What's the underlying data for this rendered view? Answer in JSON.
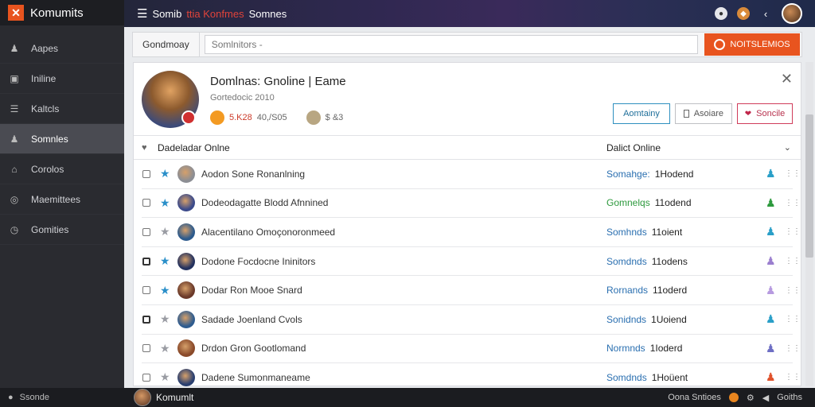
{
  "app": {
    "name": "Komumits",
    "logo_glyph": "✕"
  },
  "sidebar": {
    "items": [
      {
        "label": "Aapes",
        "icon": "person-icon",
        "glyph": "♟"
      },
      {
        "label": "Iniline",
        "icon": "bookmark-icon",
        "glyph": "▣"
      },
      {
        "label": "Kaltcls",
        "icon": "list-icon",
        "glyph": "☰"
      },
      {
        "label": "Somnles",
        "icon": "users-icon",
        "glyph": "♟",
        "active": true
      },
      {
        "label": "Corolos",
        "icon": "home-icon",
        "glyph": "⌂"
      },
      {
        "label": "Maemittees",
        "icon": "target-icon",
        "glyph": "◎"
      },
      {
        "label": "Gomities",
        "icon": "clock-icon",
        "glyph": "◷"
      }
    ]
  },
  "topbar": {
    "menu_glyph": "☰",
    "title_start": "Somib",
    "title_mid": "ttia Konfmes",
    "title_end": "Somnes"
  },
  "search": {
    "label": "Gondmoay",
    "placeholder": "Somlnitors -",
    "button_label": "NOITSLEMIOS"
  },
  "profile": {
    "name": "Domlnas: Gnoline | Eame",
    "subtitle": "Gortedocic 2010",
    "stat_a": "5.K28",
    "stat_b": "40,/S05",
    "stat_c": "$ &3",
    "close_glyph": "✕",
    "actions": {
      "primary": "Aomtainy",
      "secondary": "Asoiare",
      "danger": "Soncile"
    }
  },
  "list": {
    "header_left": "Dadeladar Onlne",
    "header_right": "Dalict Online",
    "rows": [
      {
        "name": "Aodon Sone Ronanlning",
        "status": "Somahge:",
        "count": "1Hodend",
        "starred": true,
        "checked": false,
        "avatar": "#8c8e94",
        "person": "#2a9fc8",
        "status_color": "blue"
      },
      {
        "name": "Dodeodagatte Blodd Afnnined",
        "status": "Gomnelqs",
        "count": "11odend",
        "starred": true,
        "checked": false,
        "avatar": "#3b4a8a",
        "person": "#2e9a3e",
        "status_color": "green"
      },
      {
        "name": "Alacentilano Omoçonoronmeed",
        "status": "Somhnds",
        "count": "11oient",
        "starred": false,
        "checked": false,
        "avatar": "#2c5a8c",
        "person": "#2a9fc8",
        "status_color": "blue"
      },
      {
        "name": "Dodone Focdocne Ininitors",
        "status": "Somdnds",
        "count": "11odens",
        "starred": true,
        "checked": true,
        "avatar": "#23315e",
        "person": "#9b7fcf",
        "status_color": "blue"
      },
      {
        "name": "Dodar Ron Mooe Snard",
        "status": "Rornands",
        "count": "11oderd",
        "starred": true,
        "checked": false,
        "avatar": "#6b3a2a",
        "person": "#b79be0",
        "status_color": "blue"
      },
      {
        "name": "Sadade Joenland Cvols",
        "status": "Sonidnds",
        "count": "1Uoiend",
        "starred": false,
        "checked": true,
        "avatar": "#2f5c8f",
        "person": "#2a9fc8",
        "status_color": "blue"
      },
      {
        "name": "Drdon Gron Gootlomand",
        "status": "Normnds",
        "count": "1Ioderd",
        "starred": false,
        "checked": false,
        "avatar": "#8a4a2a",
        "person": "#6e6fc4",
        "status_color": "blue"
      },
      {
        "name": "Dadene Sumonmaneame",
        "status": "Somdnds",
        "count": "1Hoüent",
        "starred": false,
        "checked": false,
        "avatar": "#2a3f70",
        "person": "#e0522c",
        "status_color": "blue"
      }
    ]
  },
  "bottombar": {
    "status": "Ssonde",
    "status_glyph": "●",
    "user": "Komumlt",
    "right_text": "Oona Sntioes",
    "right_end": "Goiths"
  },
  "colors": {
    "accent": "#e8541f",
    "link": "#2a6fb0",
    "sidebar": "#2a2b30"
  }
}
